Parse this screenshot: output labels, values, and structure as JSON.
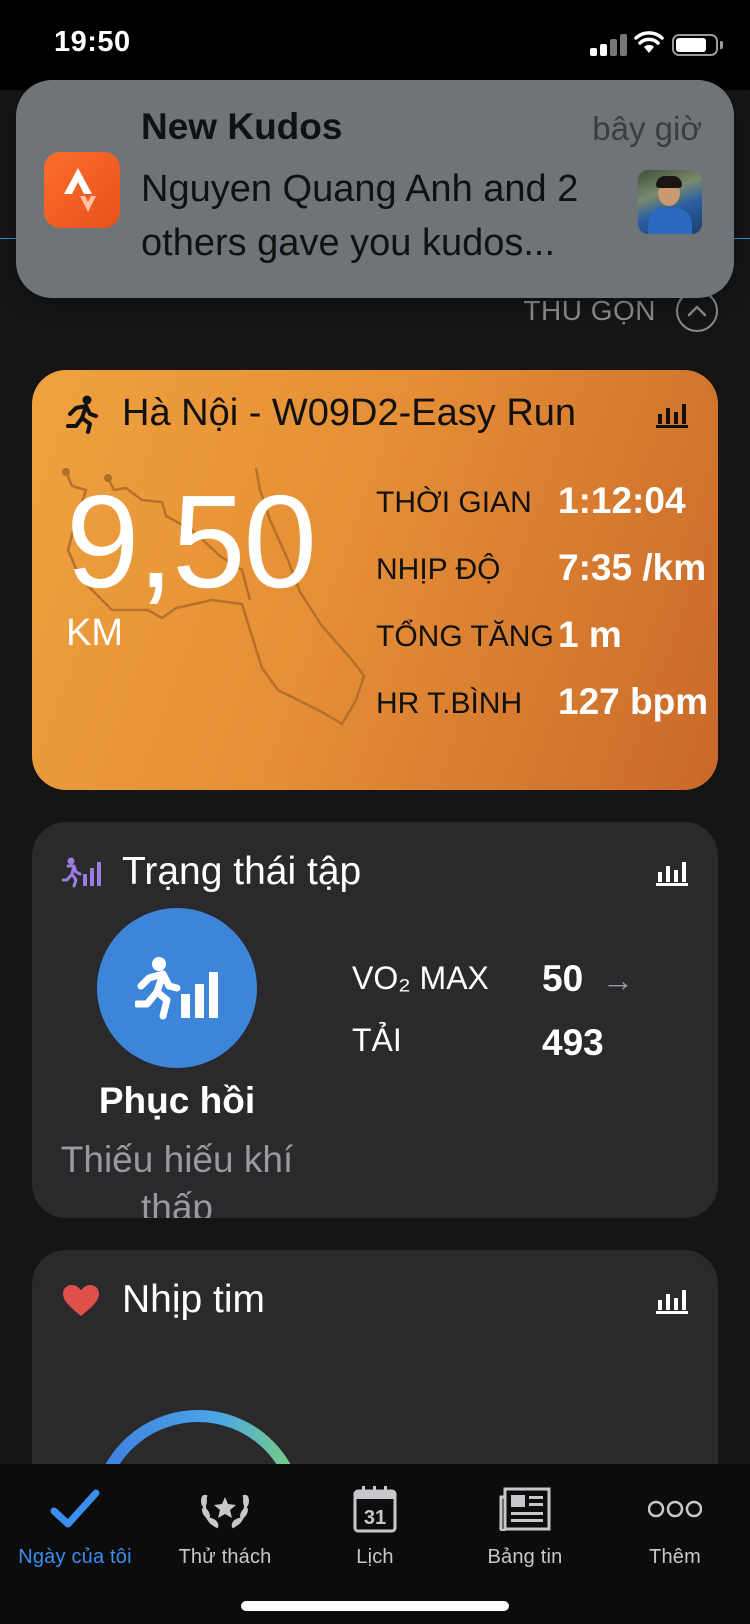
{
  "status_bar": {
    "time": "19:50"
  },
  "notification": {
    "app_icon": "strava-icon",
    "title": "New Kudos",
    "time": "bây giờ",
    "body": "Nguyen Quang Anh and 2 others gave you kudos..."
  },
  "collapse": {
    "label": "THU GỌN",
    "icon": "chevron-up-icon"
  },
  "activity": {
    "title": "Hà Nội - W09D2-Easy Run",
    "distance": "9,50",
    "unit": "KM",
    "stats": [
      {
        "label": "THỜI GIAN",
        "value": "1:12:04"
      },
      {
        "label": "NHỊP ĐỘ",
        "value": "7:35 /km"
      },
      {
        "label": "TỔNG TĂNG",
        "value": "1 m"
      },
      {
        "label": "HR T.BÌNH",
        "value": "127 bpm"
      }
    ]
  },
  "training_status": {
    "title": "Trạng thái tập",
    "status": "Phục hồi",
    "description": "Thiếu hiếu khí thấp",
    "vo2_label": "VO₂ MAX",
    "vo2_value": "50",
    "load_label": "TẢI",
    "load_value": "493"
  },
  "heart_rate": {
    "title": "Nhịp tim"
  },
  "tabs": [
    {
      "label": "Ngày của tôi",
      "icon": "checkmark-icon",
      "active": true
    },
    {
      "label": "Thử thách",
      "icon": "laurel-icon",
      "active": false
    },
    {
      "label": "Lịch",
      "icon": "calendar-icon",
      "calendar_day": "31",
      "active": false
    },
    {
      "label": "Bảng tin",
      "icon": "newsfeed-icon",
      "active": false
    },
    {
      "label": "Thêm",
      "icon": "more-icon",
      "active": false
    }
  ],
  "colors": {
    "activity_gradient_start": "#eea23e",
    "activity_gradient_end": "#c9692a",
    "accent_blue": "#3b8ef0",
    "status_circle": "#3d85d9",
    "heart": "#e0504a",
    "training_icon": "#9b7ce0"
  }
}
